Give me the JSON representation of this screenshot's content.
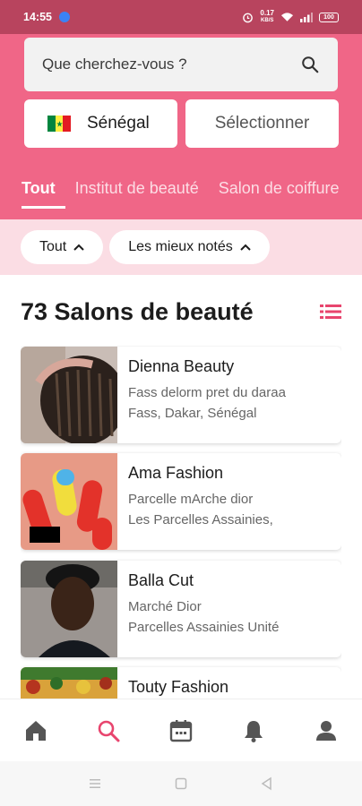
{
  "status_bar": {
    "time": "14:55",
    "speed_value": "0.17",
    "speed_unit": "KB/S",
    "battery": "100"
  },
  "search": {
    "placeholder": "Que cherchez-vous ?"
  },
  "location": {
    "country": "Sénégal",
    "select_label": "Sélectionner",
    "flag_colors": [
      "#00853f",
      "#fdef42",
      "#e31b23"
    ]
  },
  "tabs": [
    {
      "label": "Tout",
      "active": true
    },
    {
      "label": "Institut de beauté",
      "active": false
    },
    {
      "label": "Salon de coiffure",
      "active": false
    }
  ],
  "filters": {
    "category": "Tout",
    "sort": "Les mieux notés"
  },
  "list": {
    "title": "73 Salons de beauté",
    "items": [
      {
        "name": "Dienna Beauty",
        "line1": "Fass delorm pret du daraa",
        "line2": "Fass, Dakar, Sénégal"
      },
      {
        "name": "Ama Fashion",
        "line1": "Parcelle mArche dior",
        "line2": "Les Parcelles Assainies,"
      },
      {
        "name": "Balla Cut",
        "line1": "Marché Dior",
        "line2": "Parcelles Assainies Unité"
      },
      {
        "name": "Touty Fashion",
        "line1": "",
        "line2": ""
      }
    ]
  },
  "bottom_nav": [
    {
      "icon": "home-icon",
      "active": false
    },
    {
      "icon": "search-icon",
      "active": true
    },
    {
      "icon": "calendar-icon",
      "active": false
    },
    {
      "icon": "bell-icon",
      "active": false
    },
    {
      "icon": "user-icon",
      "active": false
    }
  ],
  "colors": {
    "brand": "#f06687",
    "status_bar": "#b8445e",
    "filter_bg": "#fbdde4",
    "accent": "#e8456e"
  }
}
